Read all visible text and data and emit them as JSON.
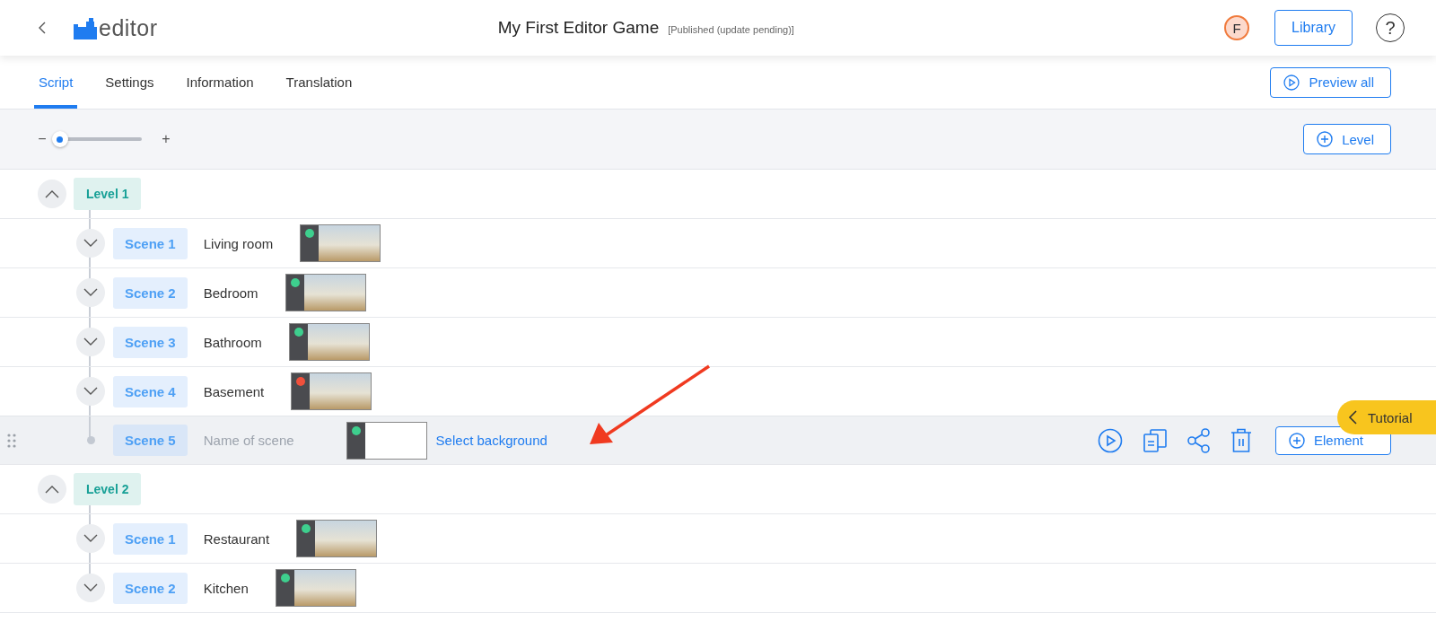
{
  "header": {
    "logo_text": "editor",
    "title": "My First Editor Game",
    "status": "[Published (update pending)]",
    "avatar": "F",
    "library_button": "Library",
    "help": "?"
  },
  "tabs": [
    {
      "label": "Script",
      "selected": true
    },
    {
      "label": "Settings",
      "selected": false
    },
    {
      "label": "Information",
      "selected": false
    },
    {
      "label": "Translation",
      "selected": false
    }
  ],
  "preview_button": "Preview all",
  "zoom": {
    "minus": "−",
    "plus": "+",
    "level": 0.05
  },
  "add_level_button": "Level",
  "levels": [
    {
      "label": "Level 1",
      "expanded": true,
      "children": [
        {
          "kind": "scene",
          "label": "Scene 1",
          "name": "Living room",
          "color": "#3ecf8e",
          "selected": false,
          "expanded": false
        },
        {
          "kind": "scene",
          "label": "Scene 2",
          "name": "Bedroom",
          "color": "#3ecf8e",
          "selected": false,
          "expanded": false
        },
        {
          "kind": "scene",
          "label": "Scene 3",
          "name": "Bathroom",
          "color": "#3ecf8e",
          "selected": false,
          "expanded": false
        },
        {
          "kind": "scene",
          "label": "Scene 4",
          "name": "Basement",
          "color": "#f0503c",
          "selected": false,
          "expanded": false
        },
        {
          "kind": "new",
          "label": "Scene 5",
          "placeholder": "Name of scene",
          "link": "Select background",
          "color": "#3ecf8e",
          "selected": true,
          "element_button": "Element"
        }
      ]
    },
    {
      "label": "Level 2",
      "expanded": true,
      "children": [
        {
          "kind": "scene",
          "label": "Scene 1",
          "name": "Restaurant",
          "color": "#3ecf8e",
          "selected": false,
          "expanded": false
        },
        {
          "kind": "scene",
          "label": "Scene 2",
          "name": "Kitchen",
          "color": "#3ecf8e",
          "selected": false,
          "expanded": false
        }
      ]
    }
  ],
  "tutorial": "Tutorial"
}
